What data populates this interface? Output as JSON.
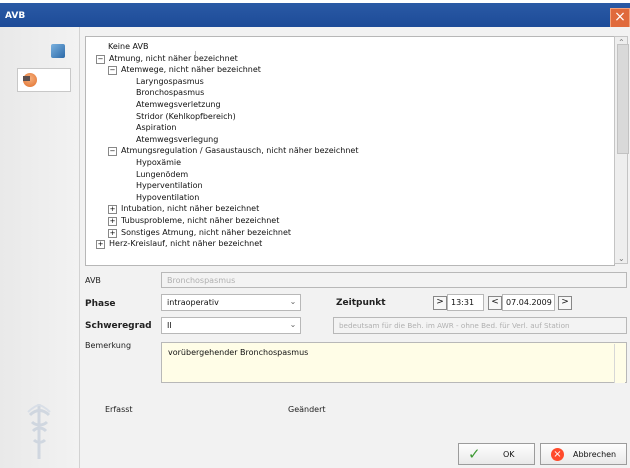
{
  "window": {
    "title": "AVB",
    "close_label": "×"
  },
  "tree": {
    "items": [
      {
        "text": "Keine AVB",
        "level": 0
      },
      {
        "text": "Atmung, nicht näher bezeichnet",
        "level": 0,
        "expander": "−"
      },
      {
        "text": "Atemwege, nicht näher bezeichnet",
        "level": 1,
        "expander": "−"
      },
      {
        "text": "Laryngospasmus",
        "level": 2
      },
      {
        "text": "Bronchospasmus",
        "level": 2
      },
      {
        "text": "Atemwegsverletzung",
        "level": 2
      },
      {
        "text": "Stridor (Kehlkopfbereich)",
        "level": 2
      },
      {
        "text": "Aspiration",
        "level": 2
      },
      {
        "text": "Atemwegsverlegung",
        "level": 2
      },
      {
        "text": "Atmungsregulation / Gasaustausch, nicht näher bezeichnet",
        "level": 1,
        "expander": "−"
      },
      {
        "text": "Hypoxämie",
        "level": 2
      },
      {
        "text": "Lungenödem",
        "level": 2
      },
      {
        "text": "Hyperventilation",
        "level": 2
      },
      {
        "text": "Hypoventilation",
        "level": 2
      },
      {
        "text": "Intubation, nicht näher bezeichnet",
        "level": 1,
        "expander": "+"
      },
      {
        "text": "Tubusprobleme, nicht näher bezeichnet",
        "level": 1,
        "expander": "+"
      },
      {
        "text": "Sonstiges Atmung, nicht näher bezeichnet",
        "level": 1,
        "expander": "+"
      },
      {
        "text": "Herz-Kreislauf, nicht näher bezeichnet",
        "level": 0,
        "expander": "+"
      }
    ]
  },
  "form": {
    "avb_label": "AVB",
    "avb_value": "Bronchospasmus",
    "phase_label": "Phase",
    "phase_value": "intraoperativ",
    "zeitpunkt_label": "Zeitpunkt",
    "time_value": "13:31",
    "date_value": "07.04.2009",
    "schweregrad_label": "Schweregrad",
    "schweregrad_value": "II",
    "schweregrad_desc": "bedeutsam für die Beh. im AWR - ohne Bed. für Verl. auf Station",
    "bemerkung_label": "Bemerkung",
    "bemerkung_value": "vorübergehender Bronchospasmus",
    "erfasst_label": "Erfasst",
    "geaendert_label": "Geändert"
  },
  "buttons": {
    "ok_label": "OK",
    "cancel_label": "Abbrechen"
  },
  "controls": {
    "arrow_left": "<",
    "arrow_right": ">"
  },
  "colors": {
    "titlebar": "#1d4b98",
    "remark_background": "#fffde7"
  }
}
